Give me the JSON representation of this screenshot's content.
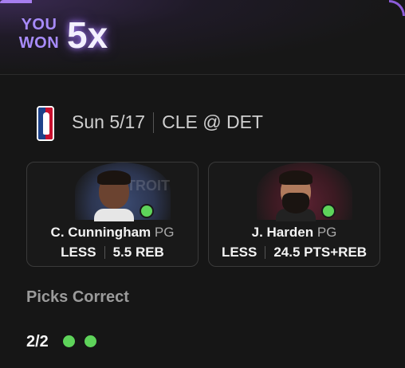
{
  "header": {
    "you_won": "YOU WON",
    "multiplier": "5x"
  },
  "game": {
    "league": "NBA",
    "league_logo_icon": "nba-logo-icon",
    "date": "Sun 5/17",
    "matchup": "CLE @ DET"
  },
  "picks": [
    {
      "player": "C. Cunningham",
      "position": "PG",
      "direction": "LESS",
      "line": "5.5",
      "stat": "REB",
      "status_color": "#5ed35a"
    },
    {
      "player": "J. Harden",
      "position": "PG",
      "direction": "LESS",
      "line": "24.5",
      "stat": "PTS+REB",
      "status_color": "#5ed35a"
    }
  ],
  "picks_correct": {
    "label": "Picks Correct",
    "count": "2/2",
    "results": [
      "correct",
      "correct"
    ]
  },
  "colors": {
    "accent": "#a78bfa",
    "success": "#5ed35a",
    "background": "#161616"
  }
}
